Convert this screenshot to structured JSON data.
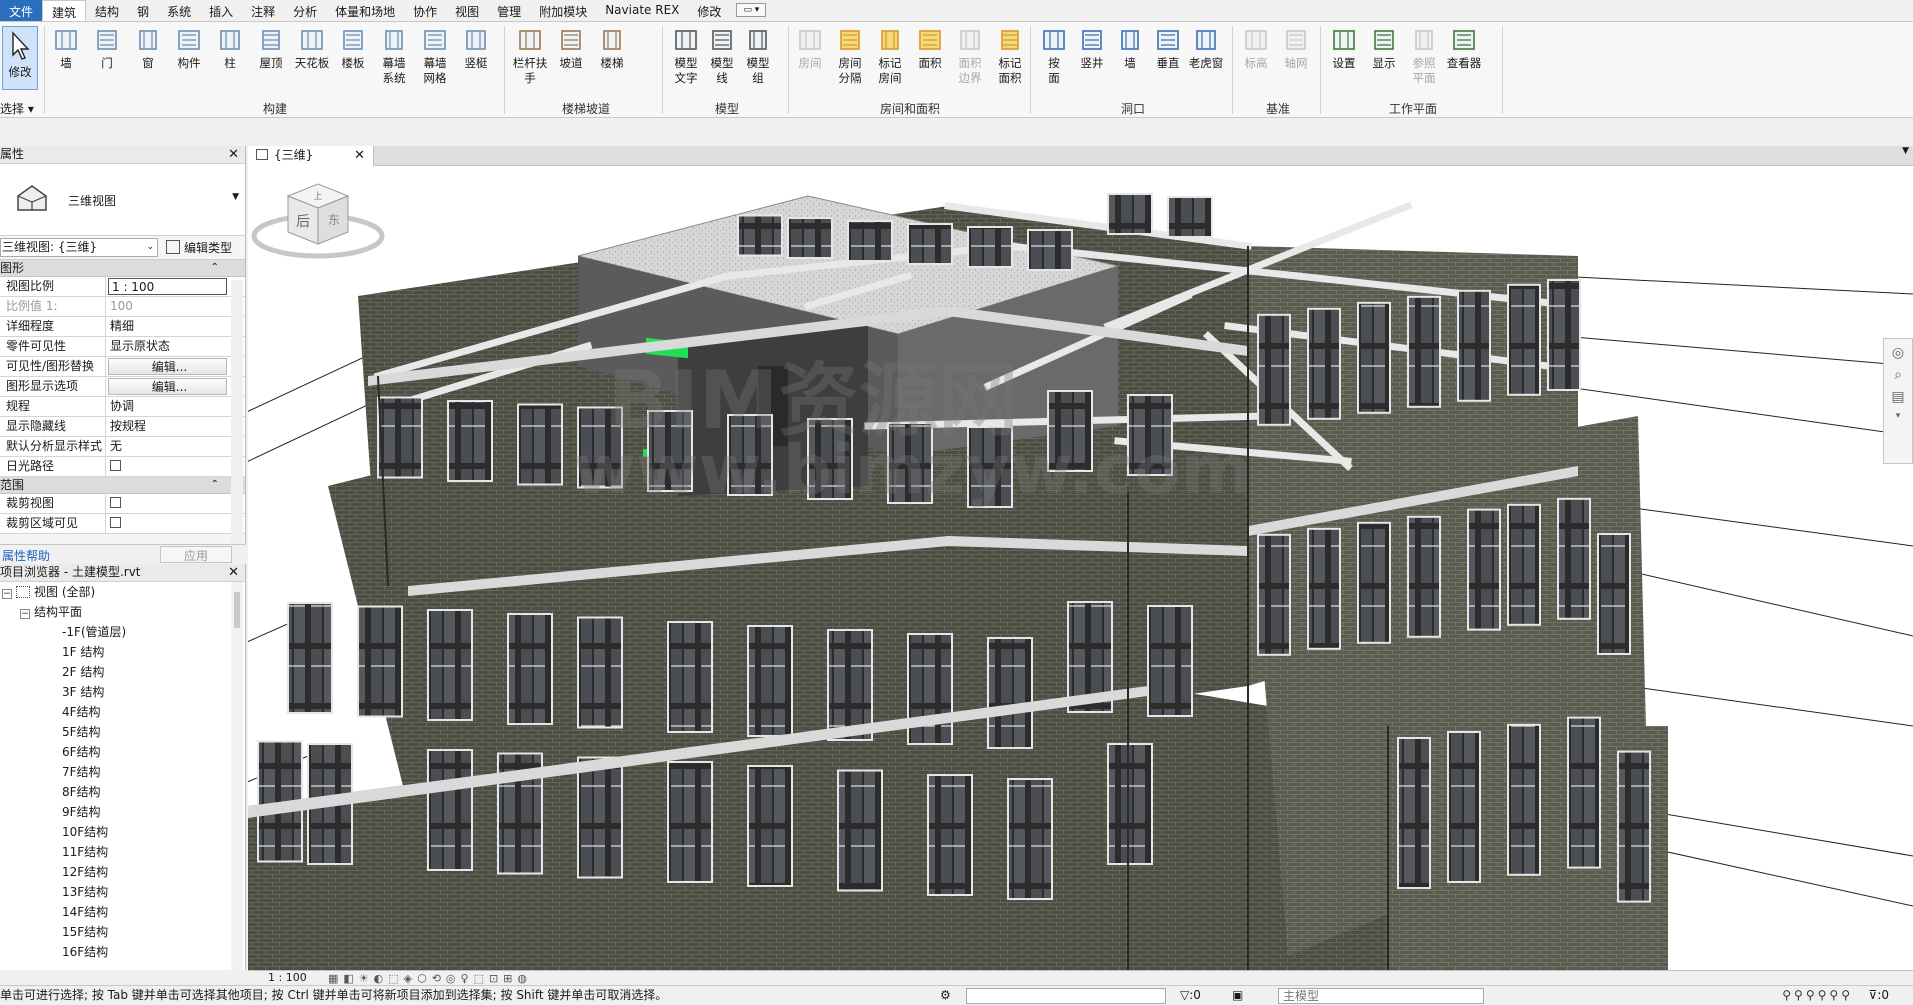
{
  "ribbon_tabs": [
    "文件",
    "建筑",
    "结构",
    "钢",
    "系统",
    "插入",
    "注释",
    "分析",
    "体量和场地",
    "协作",
    "视图",
    "管理",
    "附加模块",
    "Naviate REX",
    "修改"
  ],
  "active_tab": "建筑",
  "ribbon": {
    "select": {
      "modify_label": "修改",
      "select_label": "选择"
    },
    "build": {
      "buttons": [
        "墙",
        "门",
        "窗",
        "构件",
        "柱",
        "屋顶",
        "天花板",
        "楼板",
        "幕墙\n系统",
        "幕墙\n网格",
        "竖梃"
      ],
      "group_label": "构建"
    },
    "circulation": {
      "buttons": [
        "栏杆扶手",
        "坡道",
        "楼梯"
      ],
      "group_label": "楼梯坡道"
    },
    "model": {
      "buttons": [
        "模型\n文字",
        "模型\n线",
        "模型\n组"
      ],
      "group_label": "模型"
    },
    "room_area": {
      "buttons": [
        "房间",
        "房间\n分隔",
        "标记\n房间",
        "面积",
        "面积\n边界",
        "标记\n面积"
      ],
      "group_label": "房间和面积"
    },
    "opening": {
      "buttons": [
        "按\n面",
        "竖井",
        "墙",
        "垂直",
        "老虎窗"
      ],
      "group_label": "洞口"
    },
    "datum": {
      "buttons": [
        "标高",
        "轴网"
      ],
      "group_label": "基准"
    },
    "workplane": {
      "buttons": [
        "设置",
        "显示",
        "参照\n平面",
        "查看器"
      ],
      "group_label": "工作平面"
    }
  },
  "properties": {
    "title": "属性",
    "type_name": "三维视图",
    "instance_selector": "三维视图: {三维}",
    "edit_type": "编辑类型",
    "sections": [
      {
        "name": "图形",
        "rows": [
          {
            "k": "视图比例",
            "v": "1 : 100",
            "style": "boxed"
          },
          {
            "k": "比例值 1:",
            "v": "100",
            "style": "dim"
          },
          {
            "k": "详细程度",
            "v": "精细"
          },
          {
            "k": "零件可见性",
            "v": "显示原状态"
          },
          {
            "k": "可见性/图形替换",
            "v": "编辑...",
            "style": "btn"
          },
          {
            "k": "图形显示选项",
            "v": "编辑...",
            "style": "btn"
          },
          {
            "k": "规程",
            "v": "协调"
          },
          {
            "k": "显示隐藏线",
            "v": "按规程"
          },
          {
            "k": "默认分析显示样式",
            "v": "无"
          },
          {
            "k": "日光路径",
            "v": "",
            "style": "check"
          }
        ]
      },
      {
        "name": "范围",
        "rows": [
          {
            "k": "裁剪视图",
            "v": "",
            "style": "check"
          },
          {
            "k": "裁剪区域可见",
            "v": "",
            "style": "check"
          }
        ]
      }
    ],
    "help_link": "属性帮助",
    "apply_label": "应用"
  },
  "project_browser": {
    "title": "项目浏览器 - 土建模型.rvt",
    "root": "视图 (全部)",
    "group": "结构平面",
    "items": [
      "-1F(管道层)",
      "1F 结构",
      "2F 结构",
      "3F 结构",
      "4F结构",
      "5F结构",
      "6F结构",
      "7F结构",
      "8F结构",
      "9F结构",
      "10F结构",
      "11F结构",
      "12F结构",
      "13F结构",
      "14F结构",
      "15F结构",
      "16F结构"
    ]
  },
  "view_tab": {
    "label": "{三维}"
  },
  "viewcube": {
    "face_top": "上",
    "face_front": "后",
    "face_side": "东"
  },
  "view_control": {
    "scale": "1 : 100"
  },
  "status": {
    "message": "单击可进行选择; 按 Tab 键并单击可选择其他项目; 按 Ctrl 键并单击可将新项目添加到选择集; 按 Shift 键并单击可取消选择。",
    "selection_count": ":0",
    "model_combo": "主模型",
    "filter_count": ":0"
  },
  "watermark": {
    "line1": "BIM资源网",
    "line2": "www.bimzyw.com"
  },
  "colors": {
    "file_tab": "#2b6ebd",
    "accent_green": "#22dd55",
    "facade": "#4a4a40"
  }
}
